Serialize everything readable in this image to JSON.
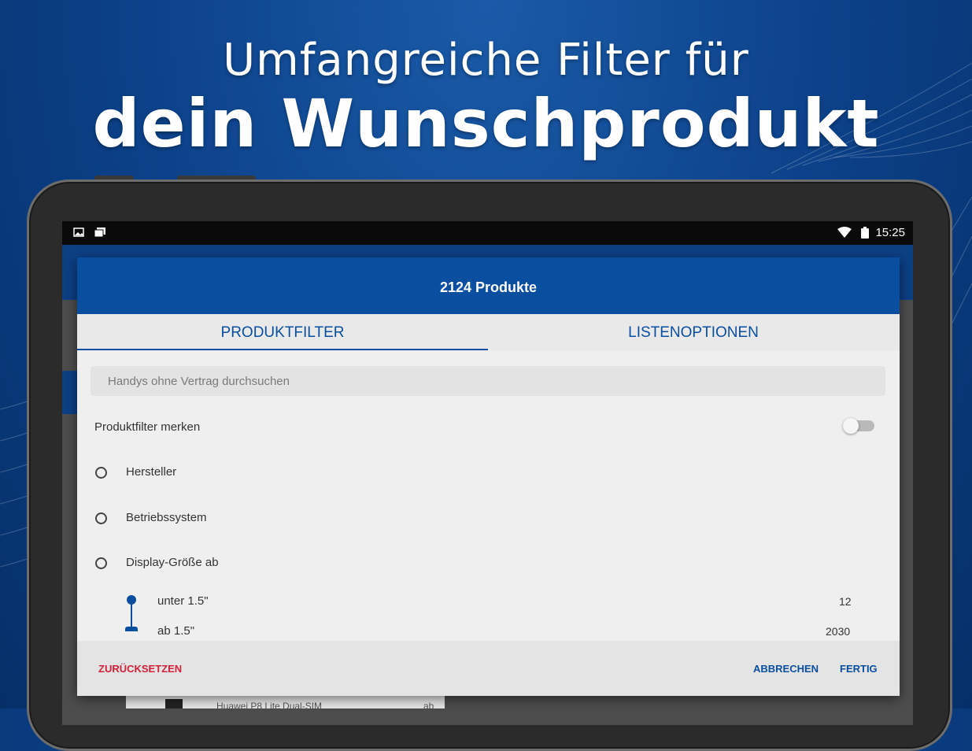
{
  "headline": {
    "line1": "Umfangreiche Filter für",
    "line2": "dein Wunschprodukt"
  },
  "status_bar": {
    "time": "15:25",
    "icons": [
      "image-icon",
      "gallery-icon",
      "wifi-icon",
      "battery-icon"
    ]
  },
  "dialog": {
    "title": "2124 Produkte",
    "tabs": [
      {
        "label": "PRODUKTFILTER",
        "active": true
      },
      {
        "label": "LISTENOPTIONEN",
        "active": false
      }
    ],
    "search": {
      "placeholder": "Handys ohne Vertrag durchsuchen"
    },
    "remember_filter": {
      "label": "Produktfilter merken",
      "enabled": false
    },
    "filters": [
      {
        "label": "Hersteller"
      },
      {
        "label": "Betriebssystem"
      },
      {
        "label": "Display-Größe ab"
      }
    ],
    "display_options": [
      {
        "label": "unter 1.5\"",
        "count": "12"
      },
      {
        "label": "ab 1.5\"",
        "count": "2030"
      }
    ],
    "footer": {
      "reset": "ZURÜCKSETZEN",
      "cancel": "ABBRECHEN",
      "done": "FERTIG"
    }
  },
  "underlay": {
    "product": "Huawei P8 Lite Dual-SIM",
    "price_prefix": "ab"
  },
  "colors": {
    "accent": "#0a4ea0",
    "reset": "#d2203a",
    "background": "#0b3f86"
  }
}
